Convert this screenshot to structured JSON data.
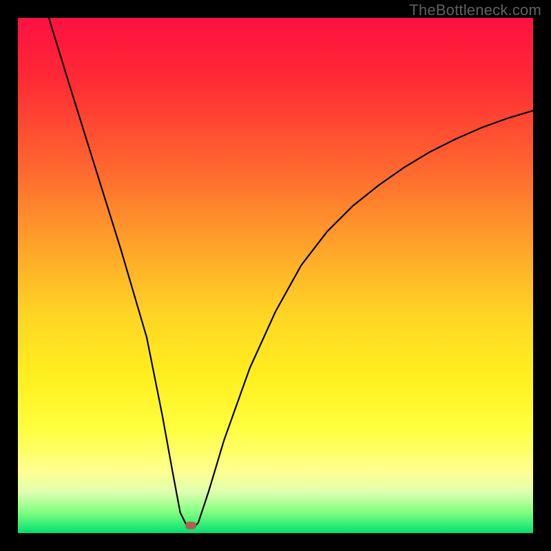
{
  "watermark": "TheBottleneck.com",
  "chart_data": {
    "type": "line",
    "title": "",
    "xlabel": "",
    "ylabel": "",
    "xlim": [
      0,
      100
    ],
    "ylim": [
      0,
      100
    ],
    "series": [
      {
        "name": "curve",
        "x": [
          6,
          10,
          15,
          20,
          25,
          28,
          30,
          31.5,
          33,
          34,
          35,
          37,
          40,
          45,
          50,
          55,
          60,
          65,
          70,
          75,
          80,
          85,
          90,
          95,
          100
        ],
        "y": [
          100,
          87,
          71,
          55,
          38,
          23,
          12,
          4,
          1,
          1,
          2,
          8,
          18,
          32,
          43,
          52,
          58.5,
          63.5,
          67.5,
          71,
          74,
          76.5,
          78.7,
          80.5,
          82
        ]
      }
    ],
    "marker": {
      "x": 33.5,
      "y": 1.5
    },
    "background": "rainbow-vertical"
  }
}
